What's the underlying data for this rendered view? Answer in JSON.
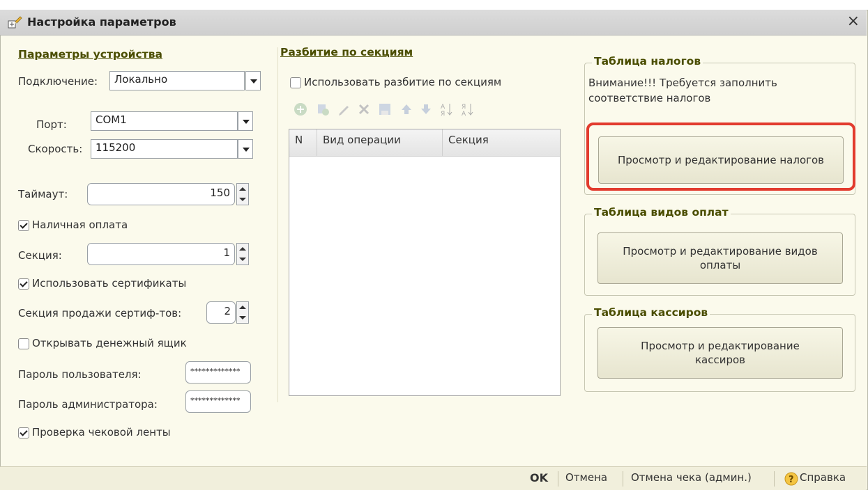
{
  "window": {
    "title": "Настройка параметров",
    "close": "×"
  },
  "device": {
    "section_title": "Параметры устройства",
    "connection_label": "Подключение:",
    "connection_value": "Локально",
    "port_label": "Порт:",
    "port_value": "COM1",
    "speed_label": "Скорость:",
    "speed_value": "115200",
    "timeout_label": "Таймаут:",
    "timeout_value": "150",
    "cash_label": "Наличная оплата",
    "cash_checked": true,
    "section_label": "Секция:",
    "section_value": "1",
    "certs_label": "Использовать сертификаты",
    "certs_checked": true,
    "cert_section_label": "Секция продажи сертиф-тов:",
    "cert_section_value": "2",
    "drawer_label": "Открывать денежный ящик",
    "drawer_checked": false,
    "user_pwd_label": "Пароль пользователя:",
    "user_pwd_value": "*************",
    "admin_pwd_label": "Пароль администратора:",
    "admin_pwd_value": "*************",
    "tape_label": "Проверка чековой ленты",
    "tape_checked": true
  },
  "sections": {
    "title": "Разбитие по секциям",
    "use_label": "Использовать разбитие по секциям",
    "use_checked": false,
    "columns": [
      "N",
      "Вид операции",
      "Секция"
    ],
    "toolbar": [
      "add-icon",
      "copy-icon",
      "edit-icon",
      "delete-icon",
      "save-icon",
      "move-up-icon",
      "move-down-icon",
      "sort-asc-icon",
      "sort-desc-icon"
    ]
  },
  "taxes": {
    "title": "Таблица налогов",
    "warning": "Внимание!!! Требуется заполнить соответствие налогов",
    "button": "Просмотр и редактирование налогов"
  },
  "payments": {
    "title": "Таблица видов оплат",
    "button": "Просмотр и редактирование видов оплаты"
  },
  "cashiers": {
    "title": "Таблица кассиров",
    "button": "Просмотр и редактирование кассиров"
  },
  "footer": {
    "ok": "OK",
    "cancel": "Отмена",
    "cancel_receipt": "Отмена чека (админ.)",
    "help": "Справка"
  },
  "colors": {
    "highlight": "#e23b2e",
    "section_title": "#4a4d00",
    "window_bg": "#fbfaec"
  }
}
